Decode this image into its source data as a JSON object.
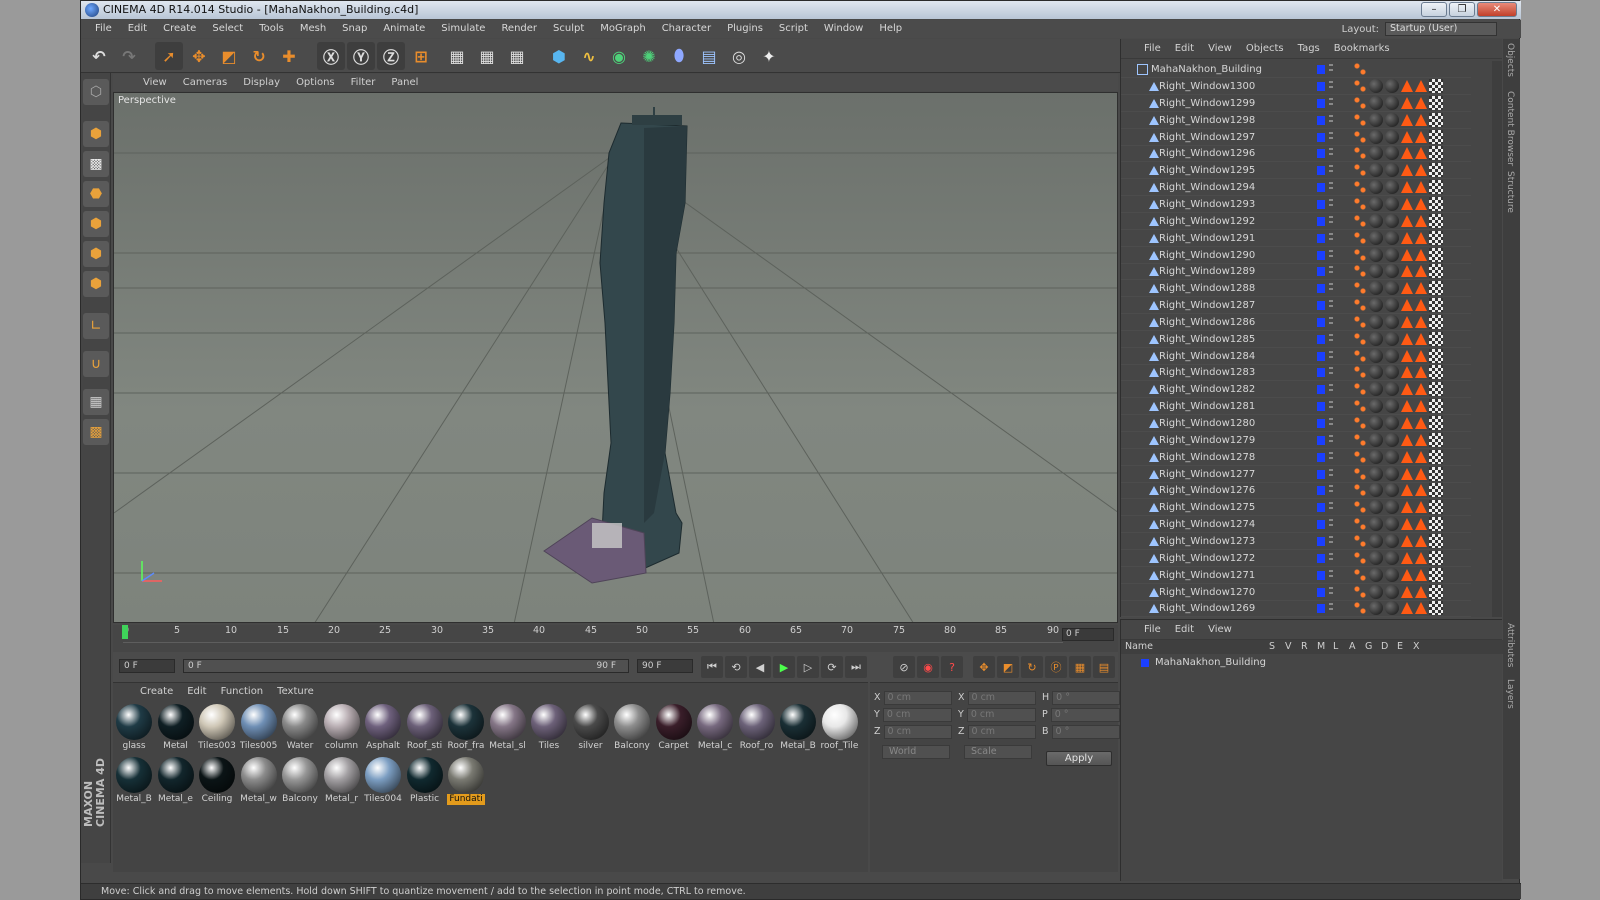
{
  "window": {
    "title": "CINEMA 4D R14.014 Studio - [MahaNakhon_Building.c4d]",
    "min": "–",
    "max": "❐",
    "close": "✕"
  },
  "menubar": [
    "File",
    "Edit",
    "Create",
    "Select",
    "Tools",
    "Mesh",
    "Snap",
    "Animate",
    "Simulate",
    "Render",
    "Sculpt",
    "MoGraph",
    "Character",
    "Plugins",
    "Script",
    "Window",
    "Help"
  ],
  "layout": {
    "label": "Layout:",
    "value": "Startup (User)"
  },
  "viewport": {
    "menu": [
      "View",
      "Cameras",
      "Display",
      "Options",
      "Filter",
      "Panel"
    ],
    "label": "Perspective"
  },
  "timeline": {
    "ticks": [
      "0",
      "5",
      "10",
      "15",
      "20",
      "25",
      "30",
      "35",
      "40",
      "45",
      "50",
      "55",
      "60",
      "65",
      "70",
      "75",
      "80",
      "85",
      "90"
    ],
    "current": "0 F"
  },
  "playbar": {
    "start": "0 F",
    "range_left": "0 F",
    "range_right": "90 F",
    "end": "90 F"
  },
  "materials": {
    "menu": [
      "Create",
      "Edit",
      "Function",
      "Texture"
    ],
    "items": [
      {
        "name": "glass",
        "color": "#1f3b46"
      },
      {
        "name": "Metal",
        "color": "#0f1f24"
      },
      {
        "name": "Tiles003",
        "color": "#cfc7b6"
      },
      {
        "name": "Tiles005",
        "color": "#6f8fb5"
      },
      {
        "name": "Water",
        "color": "#8a8a8a"
      },
      {
        "name": "column",
        "color": "#b9aeb3"
      },
      {
        "name": "Asphalt",
        "color": "#6f617e"
      },
      {
        "name": "Roof_sti",
        "color": "#6c6079"
      },
      {
        "name": "Roof_fra",
        "color": "#1c333a"
      },
      {
        "name": "Metal_sl",
        "color": "#857687"
      },
      {
        "name": "Tiles",
        "color": "#6d6179"
      },
      {
        "name": "silver",
        "color": "#4a4a4a"
      },
      {
        "name": "Balcony",
        "color": "#8e8e8e"
      },
      {
        "name": "Carpet",
        "color": "#3a1e2a"
      },
      {
        "name": "Metal_c",
        "color": "#77697f"
      },
      {
        "name": "Roof_ro",
        "color": "#6c6279"
      },
      {
        "name": "Metal_B",
        "color": "#1a2f35"
      },
      {
        "name": "roof_Tile",
        "color": "#e8e8e8"
      },
      {
        "name": "Metal_B",
        "color": "#163037"
      },
      {
        "name": "Metal_e",
        "color": "#12262c"
      },
      {
        "name": "Ceiling",
        "color": "#0b1416"
      },
      {
        "name": "Metal_w",
        "color": "#8c8c8c"
      },
      {
        "name": "Balcony",
        "color": "#979797"
      },
      {
        "name": "Metal_r",
        "color": "#a3a0a3"
      },
      {
        "name": "Tiles004",
        "color": "#7c9ec2"
      },
      {
        "name": "Plastic",
        "color": "#10292f"
      },
      {
        "name": "Fundati",
        "color": "#7a7a72",
        "selected": true
      }
    ]
  },
  "coords": {
    "rows": [
      {
        "a": "X",
        "av": "0 cm",
        "b": "X",
        "bv": "0 cm",
        "c": "H",
        "cv": "0 °"
      },
      {
        "a": "Y",
        "av": "0 cm",
        "b": "Y",
        "bv": "0 cm",
        "c": "P",
        "cv": "0 °"
      },
      {
        "a": "Z",
        "av": "0 cm",
        "b": "Z",
        "bv": "0 cm",
        "c": "B",
        "cv": "0 °"
      }
    ],
    "world": "World",
    "scale": "Scale",
    "apply": "Apply"
  },
  "objects": {
    "menu": [
      "File",
      "Edit",
      "View",
      "Objects",
      "Tags",
      "Bookmarks"
    ],
    "root": "MahaNakhon_Building",
    "items": [
      "Right_Window1300",
      "Right_Window1299",
      "Right_Window1298",
      "Right_Window1297",
      "Right_Window1296",
      "Right_Window1295",
      "Right_Window1294",
      "Right_Window1293",
      "Right_Window1292",
      "Right_Window1291",
      "Right_Window1290",
      "Right_Window1289",
      "Right_Window1288",
      "Right_Window1287",
      "Right_Window1286",
      "Right_Window1285",
      "Right_Window1284",
      "Right_Window1283",
      "Right_Window1282",
      "Right_Window1281",
      "Right_Window1280",
      "Right_Window1279",
      "Right_Window1278",
      "Right_Window1277",
      "Right_Window1276",
      "Right_Window1275",
      "Right_Window1274",
      "Right_Window1273",
      "Right_Window1272",
      "Right_Window1271",
      "Right_Window1270",
      "Right_Window1269"
    ]
  },
  "attributes": {
    "menu": [
      "File",
      "Edit",
      "View"
    ],
    "head_name": "Name",
    "head_cols": [
      "S",
      "V",
      "R",
      "M",
      "L",
      "A",
      "G",
      "D",
      "E",
      "X"
    ],
    "row_name": "MahaNakhon_Building"
  },
  "sidetabs": [
    "Objects",
    "Content Browser",
    "Structure",
    "Attributes",
    "Layers"
  ],
  "maxon": "MAXON CINEMA 4D",
  "status": "Move: Click and drag to move elements. Hold down SHIFT to quantize movement / add to the selection in point mode, CTRL to remove."
}
